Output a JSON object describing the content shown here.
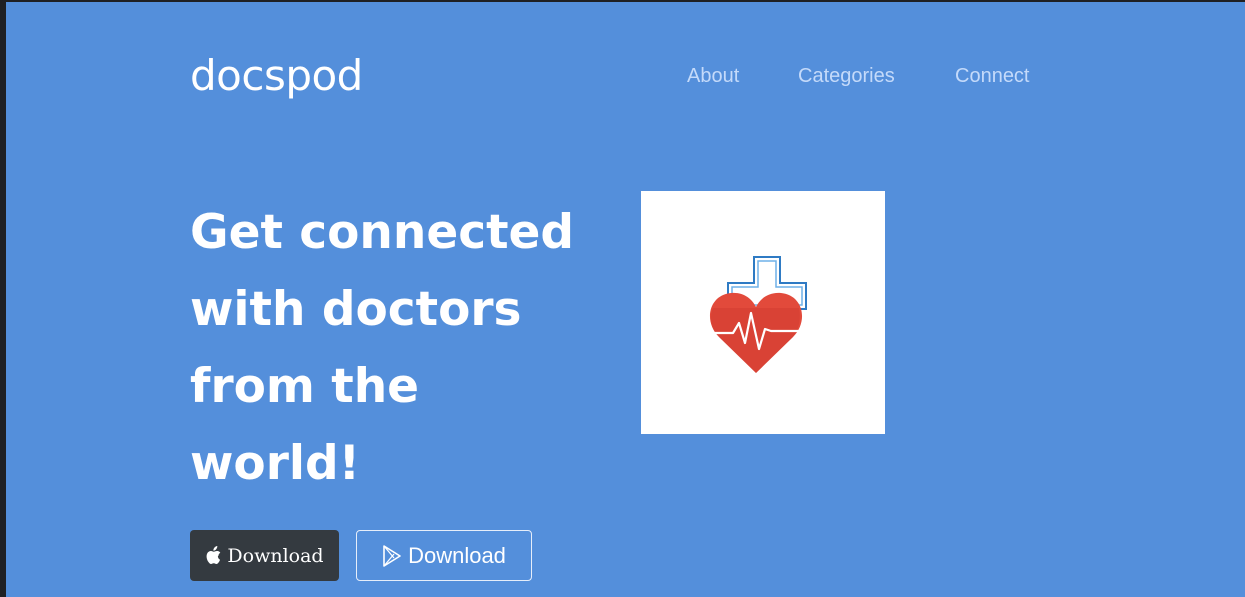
{
  "brand": {
    "name": "docspod"
  },
  "nav": {
    "items": [
      {
        "label": "About"
      },
      {
        "label": "Categories"
      },
      {
        "label": "Connect"
      }
    ]
  },
  "hero": {
    "headline_lines": [
      "Get connected",
      "with doctors",
      "from the",
      "world!"
    ],
    "image_icon": "heart-cross-icon"
  },
  "downloads": {
    "apple": {
      "label": "Download",
      "icon": "apple-icon"
    },
    "google_play": {
      "label": "Download",
      "icon": "play-store-icon"
    }
  },
  "colors": {
    "background": "#548fdb",
    "nav_link": "#c4dafa",
    "apple_button": "#343a40",
    "heart": "#e24a3b",
    "cross_outline": "#2f7bc4"
  }
}
